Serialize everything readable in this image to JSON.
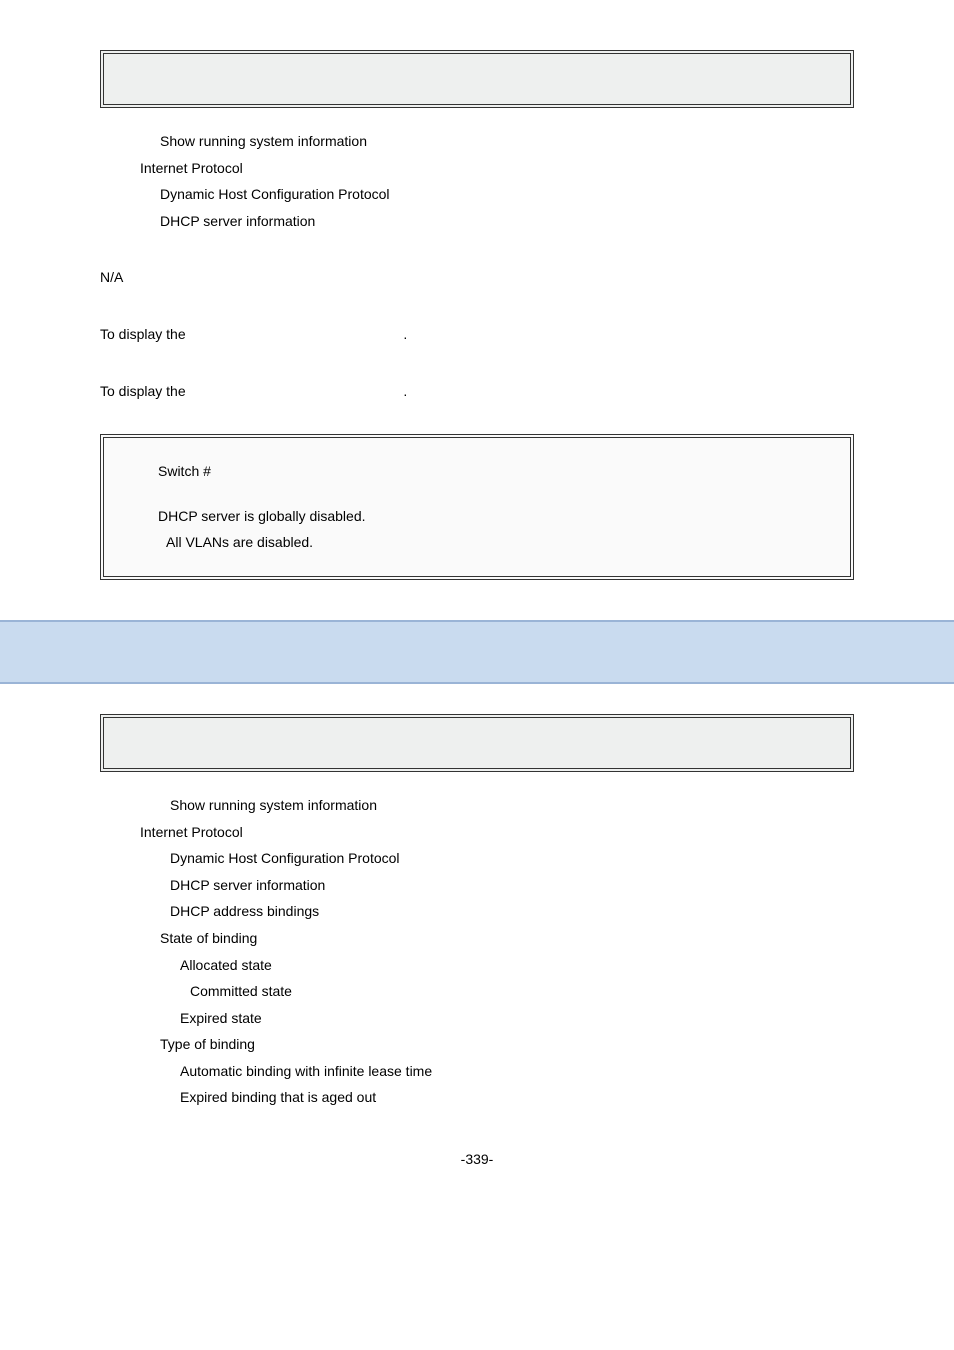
{
  "block1": {
    "syntax_placeholder": "",
    "tree": {
      "l1": "Show running system information",
      "l2": "Internet Protocol",
      "l3": "Dynamic Host Configuration Protocol",
      "l4": "DHCP server information"
    },
    "na": "N/A",
    "desc_prefix": "To display the",
    "period": ".",
    "example_prefix": "To display the",
    "output": {
      "prompt": "Switch #",
      "line1": "DHCP server is globally disabled.",
      "line2": "All VLANs are disabled."
    }
  },
  "block2": {
    "syntax_placeholder": "",
    "tree": {
      "l1": "Show running system information",
      "l2": "Internet Protocol",
      "l3": "Dynamic Host Configuration Protocol",
      "l4": "DHCP server information",
      "l5": "DHCP address bindings",
      "l6": "State of binding",
      "l7": "Allocated state",
      "l8": "Committed state",
      "l9": "Expired state",
      "l10": "Type of binding",
      "l11": "Automatic binding with infinite lease time",
      "l12": "Expired binding that is aged out"
    }
  },
  "footer": {
    "page": "-339-"
  }
}
